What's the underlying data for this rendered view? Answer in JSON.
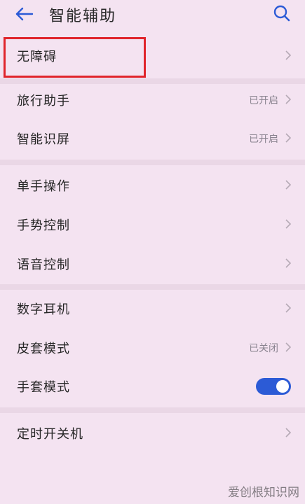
{
  "header": {
    "title": "智能辅助",
    "back_icon": "back-arrow-icon",
    "search_icon": "search-icon"
  },
  "items": [
    {
      "label": "无障碍",
      "status": ""
    },
    {
      "label": "旅行助手",
      "status": "已开启"
    },
    {
      "label": "智能识屏",
      "status": "已开启"
    },
    {
      "label": "单手操作",
      "status": ""
    },
    {
      "label": "手势控制",
      "status": ""
    },
    {
      "label": "语音控制",
      "status": ""
    },
    {
      "label": "数字耳机",
      "status": ""
    },
    {
      "label": "皮套模式",
      "status": "已关闭"
    },
    {
      "label": "手套模式",
      "toggle_on": true
    },
    {
      "label": "定时开关机",
      "status": ""
    }
  ],
  "watermark": "爱创根知识网",
  "colors": {
    "background": "#f4e3f1",
    "accent": "#2c5bd6",
    "highlight": "#e0252c"
  }
}
